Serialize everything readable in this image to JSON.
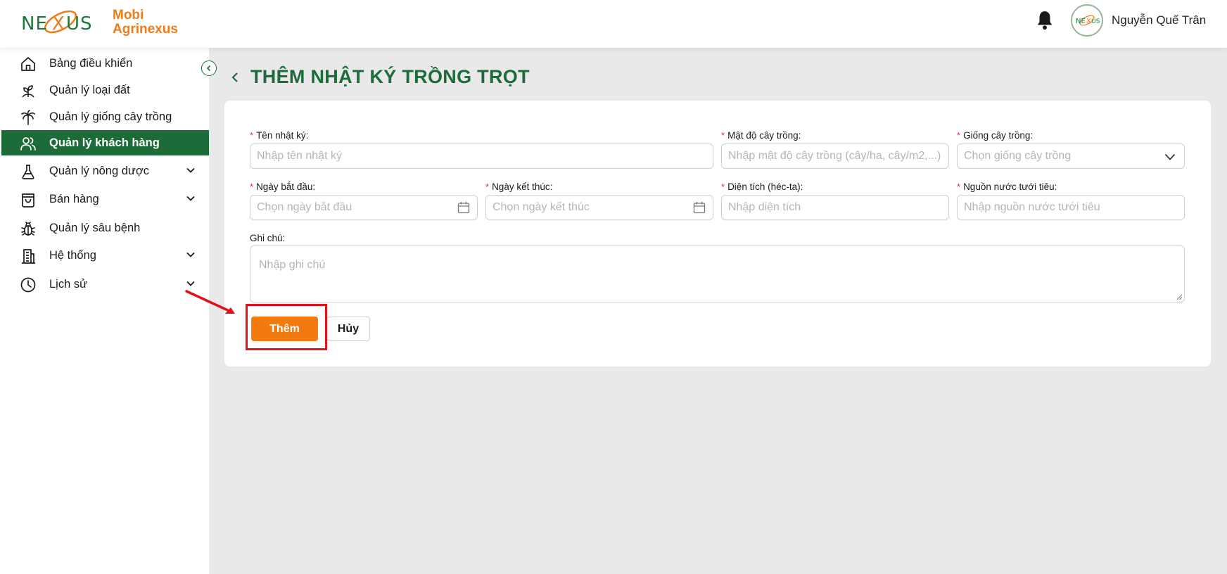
{
  "app": {
    "brand_top": "Mobi",
    "brand_bottom": "Agrinexus",
    "logo_letters": "NEXUS",
    "brand_color": "#f07b1a",
    "primary_color": "#1e6b3a",
    "accent_color": "#f27a0f"
  },
  "header": {
    "username": "Nguyễn Quế Trân",
    "notification_icon": "bell-icon",
    "avatar_icon": "nexus-logo-avatar"
  },
  "sidebar": {
    "items": [
      {
        "label": "Bảng điều khiển",
        "icon": "home-icon",
        "active": false,
        "has_submenu": false
      },
      {
        "label": "Quản lý loại đất",
        "icon": "soil-icon",
        "active": false,
        "has_submenu": false
      },
      {
        "label": "Quản lý giống cây trồng",
        "icon": "palm-tree-icon",
        "active": false,
        "has_submenu": false
      },
      {
        "label": "Quản lý khách hàng",
        "icon": "users-icon",
        "active": true,
        "has_submenu": false
      },
      {
        "label": "Quản lý nông dược",
        "icon": "flask-icon",
        "active": false,
        "has_submenu": true
      },
      {
        "label": "Bán hàng",
        "icon": "shopping-bag-icon",
        "active": false,
        "has_submenu": true
      },
      {
        "label": "Quản lý sâu bệnh",
        "icon": "bug-icon",
        "active": false,
        "has_submenu": false
      },
      {
        "label": "Hệ thống",
        "icon": "building-icon",
        "active": false,
        "has_submenu": true
      },
      {
        "label": "Lịch sử",
        "icon": "clock-icon",
        "active": false,
        "has_submenu": true
      }
    ]
  },
  "page": {
    "title": "THÊM NHẬT KÝ TRỒNG TRỌT"
  },
  "form": {
    "name": {
      "label": "Tên nhật ký:",
      "placeholder": "Nhập tên nhật ký",
      "required": true
    },
    "density": {
      "label": "Mật độ cây trồng:",
      "placeholder": "Nhập mật độ cây trồng (cây/ha, cây/m2,...)",
      "required": true
    },
    "variety": {
      "label": "Giống cây trồng:",
      "placeholder": "Chọn giống cây trồng",
      "required": true
    },
    "start_date": {
      "label": "Ngày bắt đầu:",
      "placeholder": "Chọn ngày bắt đầu",
      "required": true
    },
    "end_date": {
      "label": "Ngày kết thúc:",
      "placeholder": "Chọn ngày kết thúc",
      "required": true
    },
    "area": {
      "label": "Diện tích (héc-ta):",
      "placeholder": "Nhập diện tích",
      "required": true
    },
    "water": {
      "label": "Nguồn nước tưới tiêu:",
      "placeholder": "Nhập nguồn nước tưới tiêu",
      "required": true
    },
    "note": {
      "label": "Ghi chú:",
      "placeholder": "Nhập ghi chú",
      "required": false
    },
    "required_mark": "*",
    "submit_label": "Thêm",
    "cancel_label": "Hủy"
  },
  "annotation": {
    "highlight_color": "#e3121a",
    "target": "submit-button"
  }
}
